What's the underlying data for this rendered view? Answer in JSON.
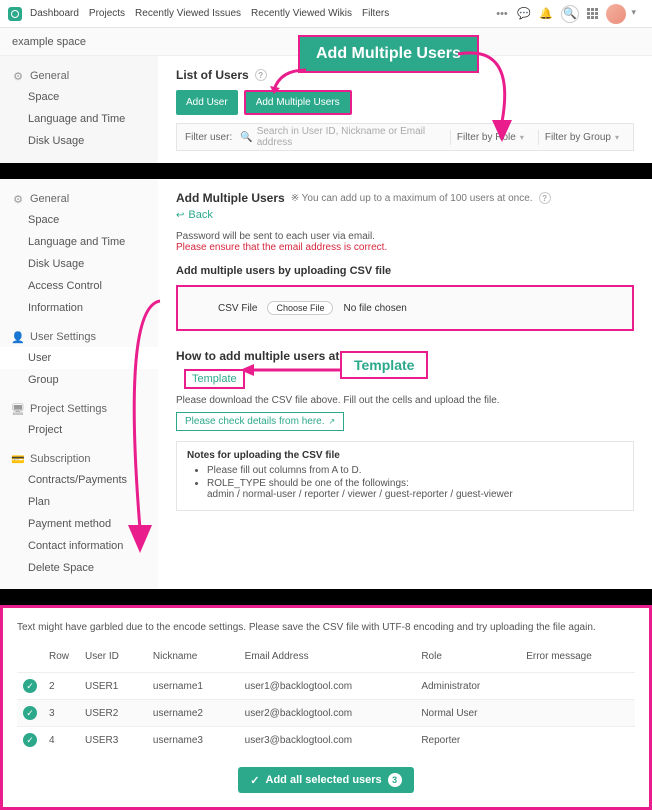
{
  "topnav": {
    "items": [
      "Dashboard",
      "Projects",
      "Recently Viewed Issues",
      "Recently Viewed Wikis",
      "Filters"
    ]
  },
  "space_name": "example space",
  "section1": {
    "sidebar_head": "General",
    "sidebar_items": [
      "Space",
      "Language and Time",
      "Disk Usage"
    ],
    "title": "List of Users",
    "btn_add_user": "Add User",
    "btn_add_multi": "Add Multiple Users",
    "filter_label": "Filter user:",
    "search_placeholder": "Search in User ID, Nickname or Email address",
    "filter_role": "Filter by Role",
    "filter_group": "Filter by Group",
    "callout": "Add Multiple Users"
  },
  "section2": {
    "sidebar": {
      "general": {
        "head": "General",
        "items": [
          "Space",
          "Language and Time",
          "Disk Usage",
          "Access Control",
          "Information"
        ]
      },
      "usersettings": {
        "head": "User Settings",
        "items": [
          "User",
          "Group"
        ],
        "active": "User"
      },
      "projectsettings": {
        "head": "Project Settings",
        "items": [
          "Project"
        ]
      },
      "subscription": {
        "head": "Subscription",
        "items": [
          "Contracts/Payments",
          "Plan",
          "Payment method",
          "Contact information",
          "Delete Space"
        ]
      }
    },
    "title": "Add Multiple Users",
    "note": "※ You can add up to a maximum of 100 users at once.",
    "back": "Back",
    "pw_note": "Password will be sent to each user via email.",
    "ensure": "Please ensure that the email address is correct.",
    "upload_head": "Add multiple users by uploading CSV file",
    "csv_label": "CSV File",
    "choose_file": "Choose File",
    "no_file": "No file chosen",
    "howto": "How to add multiple users at once.",
    "template": "Template",
    "template_callout": "Template",
    "dl_note": "Please download the CSV file above. Fill out the cells and upload the file.",
    "details_link": "Please check details from here.",
    "notes_head": "Notes for uploading the CSV file",
    "notes": [
      "Please fill out columns from A to D.",
      "ROLE_TYPE should be one of the followings:"
    ],
    "roles_line": "admin / normal-user / reporter / viewer / guest-reporter / guest-viewer"
  },
  "section3": {
    "warn": "Text might have garbled due to the encode settings. Please save the CSV file with UTF-8 encoding and try uploading the file again.",
    "cols": [
      "",
      "Row",
      "User ID",
      "Nickname",
      "Email Address",
      "Role",
      "Error message"
    ],
    "rows": [
      {
        "row": "2",
        "uid": "USER1",
        "nick": "username1",
        "email": "user1@backlogtool.com",
        "role": "Administrator"
      },
      {
        "row": "3",
        "uid": "USER2",
        "nick": "username2",
        "email": "user2@backlogtool.com",
        "role": "Normal User"
      },
      {
        "row": "4",
        "uid": "USER3",
        "nick": "username3",
        "email": "user3@backlogtool.com",
        "role": "Reporter"
      }
    ],
    "add_all": "Add all selected users",
    "count": "3"
  }
}
